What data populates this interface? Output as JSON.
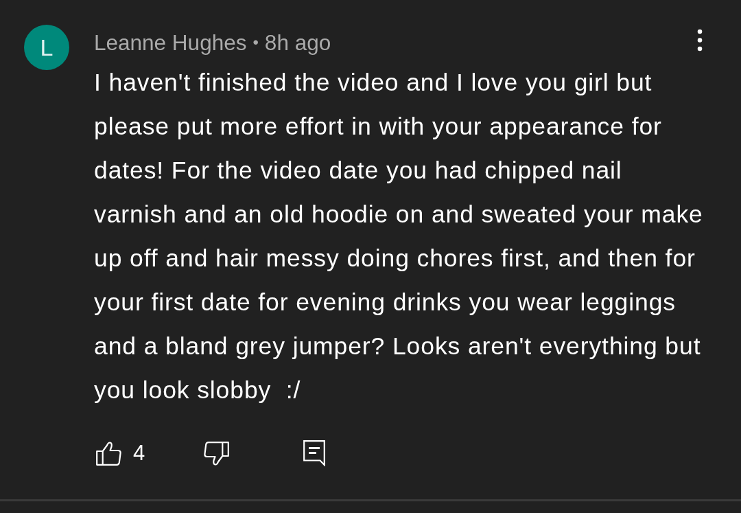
{
  "comment": {
    "avatar": {
      "letter": "L"
    },
    "author": "Leanne Hughes",
    "separator": "•",
    "time": "8h ago",
    "text": "I haven't finished the video and I love you girl but please put more effort in with your appearance for dates! For the video date you had chipped nail varnish and an old hoodie on and sweated your make up off and hair messy doing chores first, and then for your first date for evening drinks you wear leggings and a bland grey jumper? Looks aren't everything but you look slobby  :/",
    "actions": [
      {
        "kind": "like",
        "count": "4"
      },
      {
        "kind": "dislike"
      },
      {
        "kind": "reply"
      }
    ]
  }
}
